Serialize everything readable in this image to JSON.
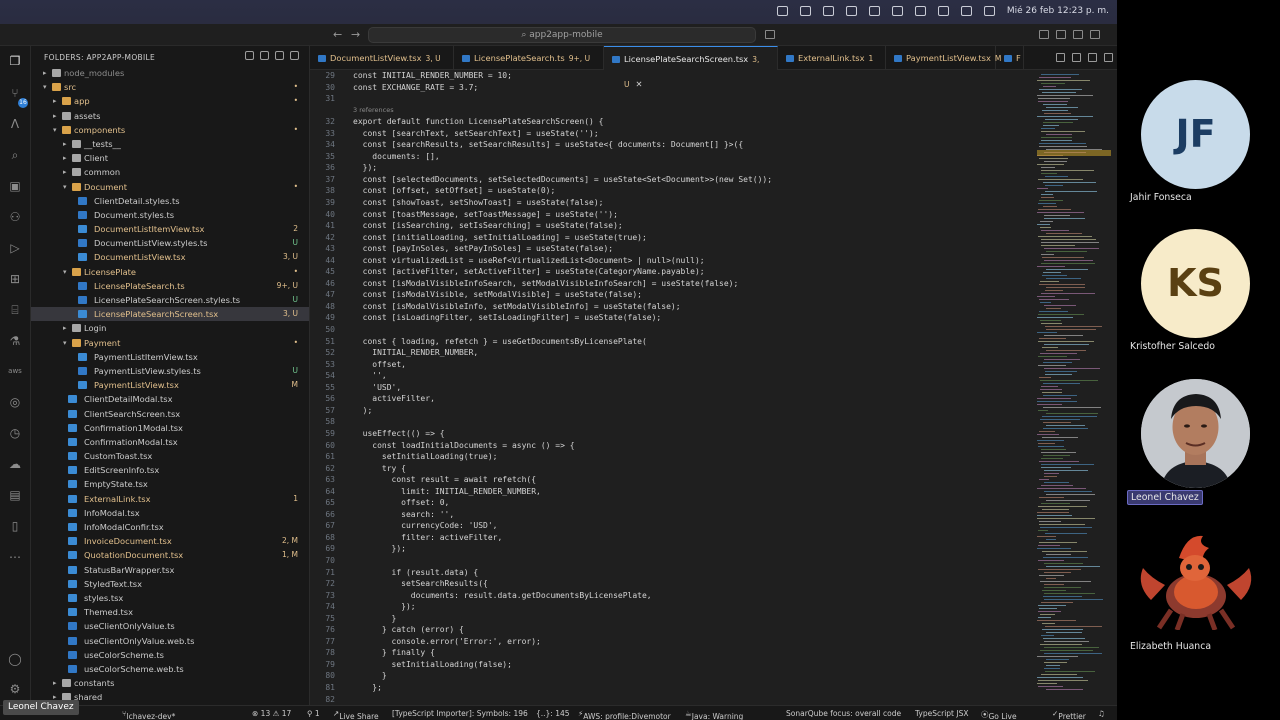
{
  "menubar": {
    "date_time": "Mié 26 feb 12:23 p. m."
  },
  "titlebar": {
    "command_center": "app2app-mobile"
  },
  "activity_bar": {
    "scm_badge": "16"
  },
  "explorer": {
    "title": "FOLDERS: APP2APP-MOBILE",
    "rows": [
      {
        "label": "node_modules",
        "depth": 1,
        "type": "folder-closed",
        "color": "#8c8c8c",
        "status": ""
      },
      {
        "label": "src",
        "depth": 1,
        "type": "folder-open",
        "color": "#e2c08d",
        "status": "•"
      },
      {
        "label": "app",
        "depth": 2,
        "type": "folder-closed",
        "color": "#e2c08d",
        "status": "•"
      },
      {
        "label": "assets",
        "depth": 2,
        "type": "folder-closed",
        "color": "#cccccc",
        "status": ""
      },
      {
        "label": "components",
        "depth": 2,
        "type": "folder-open",
        "color": "#e2c08d",
        "status": "•"
      },
      {
        "label": "__tests__",
        "depth": 3,
        "type": "folder-closed",
        "color": "#cccccc",
        "status": ""
      },
      {
        "label": "Client",
        "depth": 3,
        "type": "folder-closed",
        "color": "#cccccc",
        "status": ""
      },
      {
        "label": "common",
        "depth": 3,
        "type": "folder-closed",
        "color": "#cccccc",
        "status": ""
      },
      {
        "label": "Document",
        "depth": 3,
        "type": "folder-open",
        "color": "#e2c08d",
        "status": "•"
      },
      {
        "label": "ClientDetail.styles.ts",
        "depth": 4,
        "type": "ts",
        "color": "#cccccc",
        "status": ""
      },
      {
        "label": "Document.styles.ts",
        "depth": 4,
        "type": "ts",
        "color": "#cccccc",
        "status": ""
      },
      {
        "label": "DocumentListItemView.tsx",
        "depth": 4,
        "type": "tsx",
        "color": "#e2c08d",
        "status": "2"
      },
      {
        "label": "DocumentListView.styles.ts",
        "depth": 4,
        "type": "ts",
        "color": "#cccccc",
        "status": "U"
      },
      {
        "label": "DocumentListView.tsx",
        "depth": 4,
        "type": "tsx",
        "color": "#e2c08d",
        "status": "3, U"
      },
      {
        "label": "LicensePlate",
        "depth": 3,
        "type": "folder-open",
        "color": "#e2c08d",
        "status": "•"
      },
      {
        "label": "LicensePlateSearch.ts",
        "depth": 4,
        "type": "ts",
        "color": "#e2c08d",
        "status": "9+, U"
      },
      {
        "label": "LicensePlateSearchScreen.styles.ts",
        "depth": 4,
        "type": "ts",
        "color": "#cccccc",
        "status": "U"
      },
      {
        "label": "LicensePlateSearchScreen.tsx",
        "depth": 4,
        "type": "tsx",
        "color": "#e2c08d",
        "status": "3, U",
        "selected": true
      },
      {
        "label": "Login",
        "depth": 3,
        "type": "folder-closed",
        "color": "#cccccc",
        "status": ""
      },
      {
        "label": "Payment",
        "depth": 3,
        "type": "folder-open",
        "color": "#e2c08d",
        "status": "•"
      },
      {
        "label": "PaymentListItemView.tsx",
        "depth": 4,
        "type": "tsx",
        "color": "#cccccc",
        "status": ""
      },
      {
        "label": "PaymentListView.styles.ts",
        "depth": 4,
        "type": "ts",
        "color": "#cccccc",
        "status": "U"
      },
      {
        "label": "PaymentListView.tsx",
        "depth": 4,
        "type": "tsx",
        "color": "#e2c08d",
        "status": "M"
      },
      {
        "label": "ClientDetailModal.tsx",
        "depth": 3,
        "type": "tsx",
        "color": "#cccccc",
        "status": ""
      },
      {
        "label": "ClientSearchScreen.tsx",
        "depth": 3,
        "type": "tsx",
        "color": "#cccccc",
        "status": ""
      },
      {
        "label": "Confirmation1Modal.tsx",
        "depth": 3,
        "type": "tsx",
        "color": "#cccccc",
        "status": ""
      },
      {
        "label": "ConfirmationModal.tsx",
        "depth": 3,
        "type": "tsx",
        "color": "#cccccc",
        "status": ""
      },
      {
        "label": "CustomToast.tsx",
        "depth": 3,
        "type": "tsx",
        "color": "#cccccc",
        "status": ""
      },
      {
        "label": "EditScreenInfo.tsx",
        "depth": 3,
        "type": "tsx",
        "color": "#cccccc",
        "status": ""
      },
      {
        "label": "EmptyState.tsx",
        "depth": 3,
        "type": "tsx",
        "color": "#cccccc",
        "status": ""
      },
      {
        "label": "ExternalLink.tsx",
        "depth": 3,
        "type": "tsx",
        "color": "#e2c08d",
        "status": "1"
      },
      {
        "label": "InfoModal.tsx",
        "depth": 3,
        "type": "tsx",
        "color": "#cccccc",
        "status": ""
      },
      {
        "label": "InfoModalConfir.tsx",
        "depth": 3,
        "type": "tsx",
        "color": "#cccccc",
        "status": ""
      },
      {
        "label": "InvoiceDocument.tsx",
        "depth": 3,
        "type": "tsx",
        "color": "#e2c08d",
        "status": "2, M"
      },
      {
        "label": "QuotationDocument.tsx",
        "depth": 3,
        "type": "tsx",
        "color": "#e2c08d",
        "status": "1, M"
      },
      {
        "label": "StatusBarWrapper.tsx",
        "depth": 3,
        "type": "tsx",
        "color": "#cccccc",
        "status": ""
      },
      {
        "label": "StyledText.tsx",
        "depth": 3,
        "type": "tsx",
        "color": "#cccccc",
        "status": ""
      },
      {
        "label": "styles.tsx",
        "depth": 3,
        "type": "tsx",
        "color": "#cccccc",
        "status": ""
      },
      {
        "label": "Themed.tsx",
        "depth": 3,
        "type": "tsx",
        "color": "#cccccc",
        "status": ""
      },
      {
        "label": "useClientOnlyValue.ts",
        "depth": 3,
        "type": "ts",
        "color": "#cccccc",
        "status": ""
      },
      {
        "label": "useClientOnlyValue.web.ts",
        "depth": 3,
        "type": "ts",
        "color": "#cccccc",
        "status": ""
      },
      {
        "label": "useColorScheme.ts",
        "depth": 3,
        "type": "ts",
        "color": "#cccccc",
        "status": ""
      },
      {
        "label": "useColorScheme.web.ts",
        "depth": 3,
        "type": "ts",
        "color": "#cccccc",
        "status": ""
      },
      {
        "label": "constants",
        "depth": 2,
        "type": "folder-closed",
        "color": "#cccccc",
        "status": ""
      },
      {
        "label": "shared",
        "depth": 2,
        "type": "folder-closed",
        "color": "#cccccc",
        "status": ""
      }
    ]
  },
  "tabs": [
    {
      "label": "DocumentListView.tsx",
      "status": "3, U",
      "status_color": "#e2c08d",
      "active": false
    },
    {
      "label": "LicensePlateSearch.ts",
      "status": "9+, U",
      "status_color": "#e2c08d",
      "active": false
    },
    {
      "label": "LicensePlateSearchScreen.tsx",
      "status": "3, U",
      "status_color": "#e2c08d",
      "active": true
    },
    {
      "label": "ExternalLink.tsx",
      "status": "1",
      "status_color": "#e2c08d",
      "active": false
    },
    {
      "label": "PaymentListView.tsx",
      "status": "M",
      "status_color": "#e2c08d",
      "active": false
    },
    {
      "label": "F",
      "status": "",
      "status_color": "#cccccc",
      "active": false
    }
  ],
  "code": [
    {
      "n": "29",
      "t": "const INITIAL_RENDER_NUMBER = 10;"
    },
    {
      "n": "30",
      "t": "const EXCHANGE_RATE = 3.7;"
    },
    {
      "n": "31",
      "t": ""
    },
    {
      "n": "",
      "t": "3 references",
      "hint": true
    },
    {
      "n": "32",
      "t": "export default function LicensePlateSearchScreen() {"
    },
    {
      "n": "33",
      "t": "  const [searchText, setSearchText] = useState('');"
    },
    {
      "n": "34",
      "t": "  const [searchResults, setSearchResults] = useState<{ documents: Document[] }>({"
    },
    {
      "n": "35",
      "t": "    documents: [],"
    },
    {
      "n": "36",
      "t": "  });"
    },
    {
      "n": "37",
      "t": "  const [selectedDocuments, setSelectedDocuments] = useState<Set<Document>>(new Set());"
    },
    {
      "n": "38",
      "t": "  const [offset, setOffset] = useState(0);"
    },
    {
      "n": "39",
      "t": "  const [showToast, setShowToast] = useState(false);"
    },
    {
      "n": "40",
      "t": "  const [toastMessage, setToastMessage] = useState('');"
    },
    {
      "n": "41",
      "t": "  const [isSearching, setIsSearching] = useState(false);"
    },
    {
      "n": "42",
      "t": "  const [initialLoading, setInitialLoading] = useState(true);"
    },
    {
      "n": "43",
      "t": "  const [payInSoles, setPayInSoles] = useState(false);"
    },
    {
      "n": "44",
      "t": "  const virtualizedList = useRef<VirtualizedList<Document> | null>(null);"
    },
    {
      "n": "45",
      "t": "  const [activeFilter, setActiveFilter] = useState(CategoryName.payable);"
    },
    {
      "n": "46",
      "t": "  const [isModalVisibleInfoSearch, setModalVisibleInfoSearch] = useState(false);"
    },
    {
      "n": "47",
      "t": "  const [isModalVisible, setModalVisible] = useState(false);"
    },
    {
      "n": "48",
      "t": "  const [isModalVisibleInfo, setModalVisibleInfo] = useState(false);"
    },
    {
      "n": "49",
      "t": "  const [isLoadingFilter, setIsLoadingFilter] = useState(false);"
    },
    {
      "n": "50",
      "t": ""
    },
    {
      "n": "51",
      "t": "  const { loading, refetch } = useGetDocumentsByLicensePlate("
    },
    {
      "n": "52",
      "t": "    INITIAL_RENDER_NUMBER,"
    },
    {
      "n": "53",
      "t": "    offset,"
    },
    {
      "n": "54",
      "t": "    '',"
    },
    {
      "n": "55",
      "t": "    'USD',"
    },
    {
      "n": "56",
      "t": "    activeFilter,"
    },
    {
      "n": "57",
      "t": "  );"
    },
    {
      "n": "58",
      "t": ""
    },
    {
      "n": "59",
      "t": "  useEffect(() => {"
    },
    {
      "n": "60",
      "t": "    const loadInitialDocuments = async () => {"
    },
    {
      "n": "61",
      "t": "      setInitialLoading(true);"
    },
    {
      "n": "62",
      "t": "      try {"
    },
    {
      "n": "63",
      "t": "        const result = await refetch({"
    },
    {
      "n": "64",
      "t": "          limit: INITIAL_RENDER_NUMBER,"
    },
    {
      "n": "65",
      "t": "          offset: 0,"
    },
    {
      "n": "66",
      "t": "          search: '',"
    },
    {
      "n": "67",
      "t": "          currencyCode: 'USD',"
    },
    {
      "n": "68",
      "t": "          filter: activeFilter,"
    },
    {
      "n": "69",
      "t": "        });"
    },
    {
      "n": "70",
      "t": ""
    },
    {
      "n": "71",
      "t": "        if (result.data) {"
    },
    {
      "n": "72",
      "t": "          setSearchResults({"
    },
    {
      "n": "73",
      "t": "            documents: result.data.getDocumentsByLicensePlate,"
    },
    {
      "n": "74",
      "t": "          });"
    },
    {
      "n": "75",
      "t": "        }"
    },
    {
      "n": "76",
      "t": "      } catch (error) {"
    },
    {
      "n": "77",
      "t": "        console.error('Error:', error);"
    },
    {
      "n": "78",
      "t": "      } finally {"
    },
    {
      "n": "79",
      "t": "        setInitialLoading(false);"
    },
    {
      "n": "80",
      "t": "      }"
    },
    {
      "n": "81",
      "t": "    };"
    },
    {
      "n": "82",
      "t": ""
    }
  ],
  "statusbar": {
    "branch": "lchavez-dev*",
    "problems": "⊗ 13 ⚠ 17",
    "ports": "⚲ 1",
    "live_share": "Live Share",
    "ts_importer": "[TypeScript Importer]: Symbols: 196",
    "selection": "{..}: 145",
    "aws": "AWS: profile:Divemotor",
    "java": "Java: Warning",
    "sonar": "SonarQube focus: overall code",
    "language": "TypeScript JSX",
    "golive": "Go Live",
    "prettier": "Prettier"
  },
  "meeting": {
    "self_name": "Leonel Chavez",
    "participants": [
      {
        "initials": "JF",
        "name": "Jahir Fonseca",
        "bg": "#c8dbea",
        "fg": "#1c3d63"
      },
      {
        "initials": "KS",
        "name": "Kristofher Salcedo",
        "bg": "#f7ebc9",
        "fg": "#5a4012"
      },
      {
        "initials": "",
        "name": "Leonel Chavez",
        "bg": "#b9bdc3",
        "fg": "#ffffff"
      },
      {
        "initials": "",
        "name": "Elizabeth Huanca",
        "bg": "#000000",
        "fg": "#ffffff"
      }
    ]
  }
}
